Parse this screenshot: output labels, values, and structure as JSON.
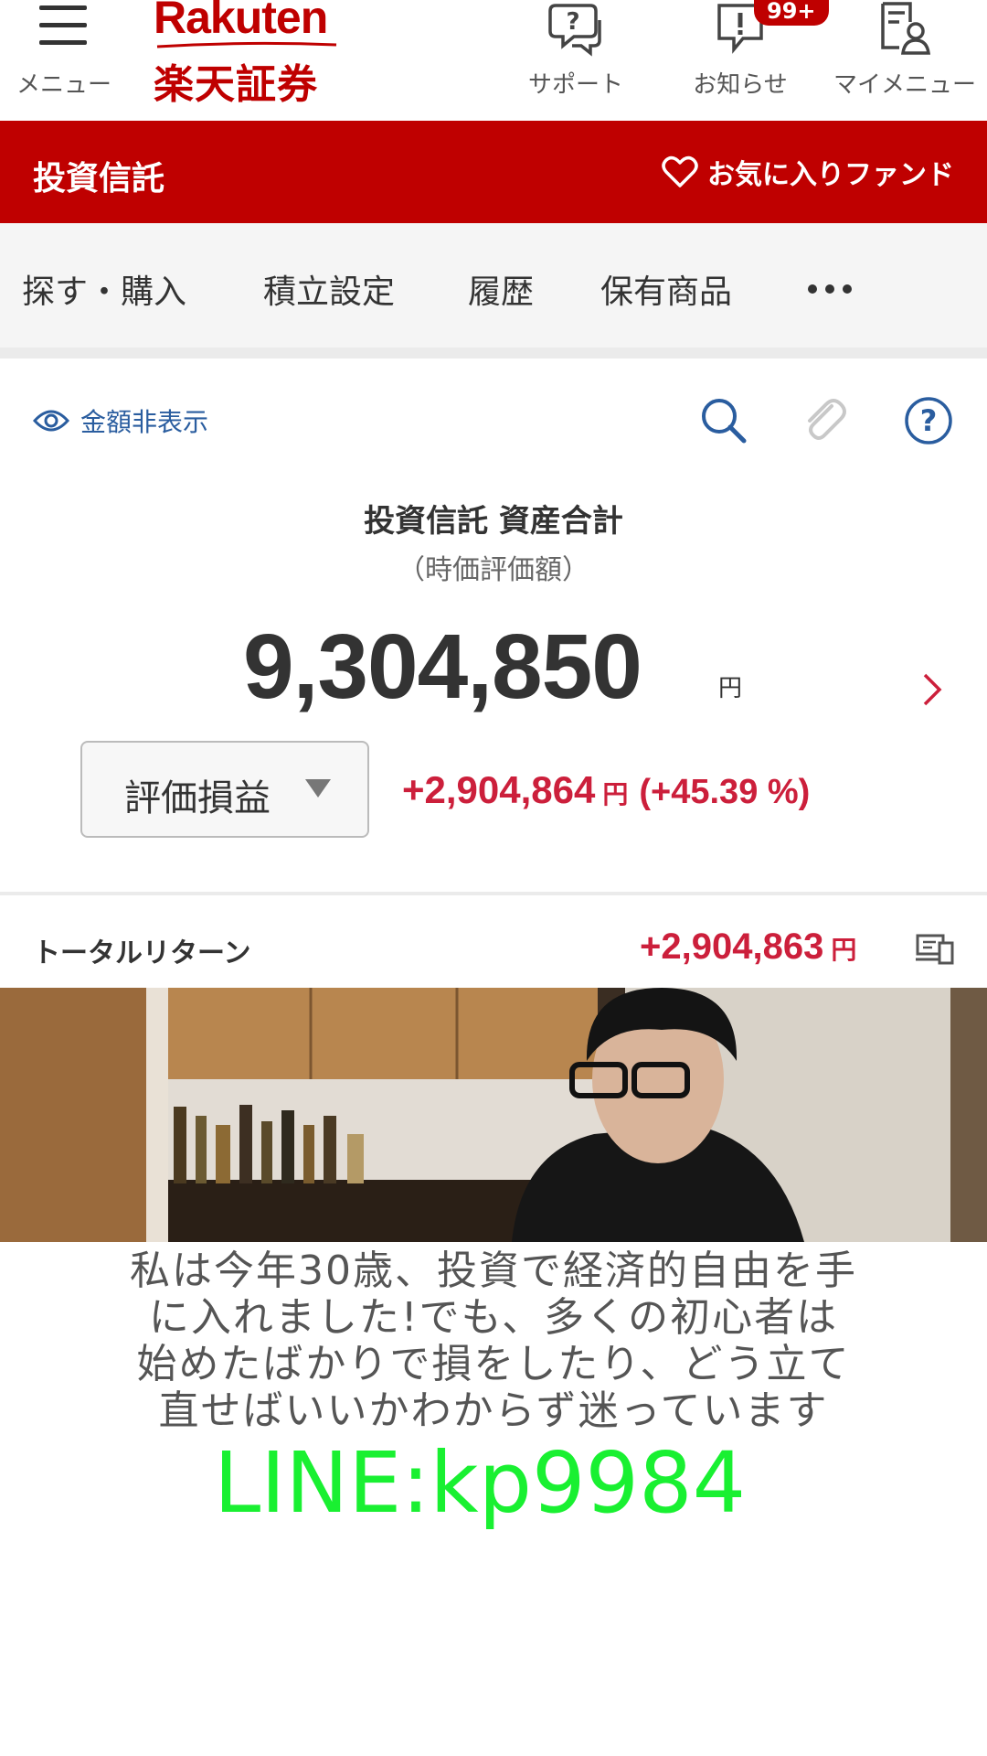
{
  "header": {
    "menu_label": "メニュー",
    "logo_en": "Rakuten",
    "logo_jp": "楽天証券",
    "support_label": "サポート",
    "notice_label": "お知らせ",
    "notice_badge": "99+",
    "mymenu_label": "マイメニュー"
  },
  "section_bar": {
    "title": "投資信託",
    "favorite_label": "お気に入りファンド"
  },
  "tabs": [
    {
      "label": "探す・購入"
    },
    {
      "label": "積立設定"
    },
    {
      "label": "履歴"
    },
    {
      "label": "保有商品"
    }
  ],
  "panel": {
    "hide_amount_label": "金額非表示",
    "total_title": "投資信託 資産合計",
    "total_subtitle": "（時価評価額）",
    "total_amount": "9,304,850",
    "total_unit": "円",
    "gain_select": "評価損益",
    "gain_value": "+2,904,864",
    "gain_unit": "円",
    "gain_percent": "(+45.39 %)"
  },
  "total_return": {
    "label": "トータルリターン",
    "value": "+2,904,863",
    "unit": "円"
  },
  "caption": {
    "line1": "私は今年30歳、投資で経済的自由を手",
    "line2": "に入れました!でも、多くの初心者は",
    "line3": "始めたばかりで損をしたり、どう立て",
    "line4": "直せばいいかわからず迷っています",
    "contact": "LINE:kp9984"
  },
  "colors": {
    "brand_red": "#bf0000",
    "gain_red": "#cc1f3b",
    "link_blue": "#2a5d9f",
    "contact_green": "#19f031"
  },
  "icons": [
    "hamburger-icon",
    "support-chat-icon",
    "notice-icon",
    "mymenu-icon",
    "heart-icon",
    "eye-icon",
    "search-icon",
    "clip-icon",
    "help-icon",
    "chevron-right-icon",
    "caret-down-icon",
    "devices-icon"
  ]
}
